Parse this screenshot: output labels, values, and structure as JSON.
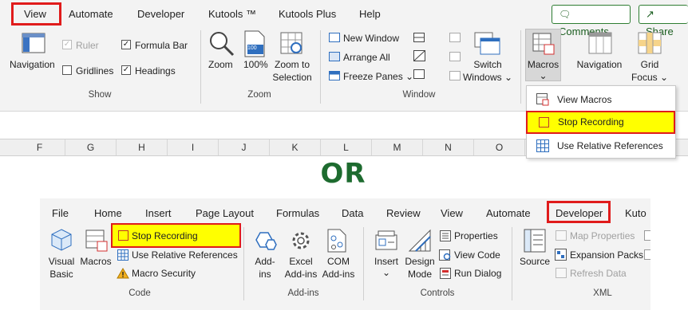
{
  "top_ribbon": {
    "tabs": [
      "View",
      "Automate",
      "Developer",
      "Kutools ™",
      "Kutools Plus",
      "Help"
    ],
    "comments_label": "Comments",
    "share_label": "Share",
    "show": {
      "navigation": "Navigation",
      "ruler": "Ruler",
      "formula_bar": "Formula Bar",
      "gridlines": "Gridlines",
      "headings": "Headings",
      "group": "Show"
    },
    "zoom": {
      "zoom": "Zoom",
      "hundred": "100%",
      "hundred_icon": "100",
      "zoom_to": "Zoom to",
      "selection": "Selection",
      "group": "Zoom"
    },
    "window": {
      "new_window": "New Window",
      "arrange_all": "Arrange All",
      "freeze_panes": "Freeze Panes",
      "switch": "Switch",
      "windows": "Windows",
      "group": "Window"
    },
    "macros": {
      "label": "Macros"
    },
    "navigation2": "Navigation",
    "grid_focus_1": "Grid",
    "grid_focus_2": "Focus"
  },
  "macros_menu": {
    "items": [
      "View Macros",
      "Stop Recording",
      "Use Relative References"
    ]
  },
  "column_headers": [
    "F",
    "G",
    "H",
    "I",
    "J",
    "K",
    "L",
    "M",
    "N",
    "O"
  ],
  "or_text": "OR",
  "bottom_ribbon": {
    "tabs": [
      "File",
      "Home",
      "Insert",
      "Page Layout",
      "Formulas",
      "Data",
      "Review",
      "View",
      "Automate",
      "Developer",
      "Kuto"
    ],
    "code": {
      "visual_basic_1": "Visual",
      "visual_basic_2": "Basic",
      "macros": "Macros",
      "stop_recording": "Stop Recording",
      "use_relative": "Use Relative References",
      "macro_security": "Macro Security",
      "group": "Code"
    },
    "addins": {
      "addins_1": "Add-",
      "addins_2": "ins",
      "excel_1": "Excel",
      "excel_2": "Add-ins",
      "com_1": "COM",
      "com_2": "Add-ins",
      "group": "Add-ins"
    },
    "controls": {
      "insert": "Insert",
      "design_1": "Design",
      "design_2": "Mode",
      "properties": "Properties",
      "view_code": "View Code",
      "run_dialog": "Run Dialog",
      "group": "Controls"
    },
    "xml": {
      "source": "Source",
      "map_properties": "Map Properties",
      "expansion_packs": "Expansion Packs",
      "refresh_data": "Refresh Data",
      "group": "XML"
    }
  },
  "colors": {
    "highlight_red": "#e01b1b",
    "highlight_yellow": "#ffff00",
    "or_green": "#1d6b2f",
    "excel_green": "#217346"
  }
}
